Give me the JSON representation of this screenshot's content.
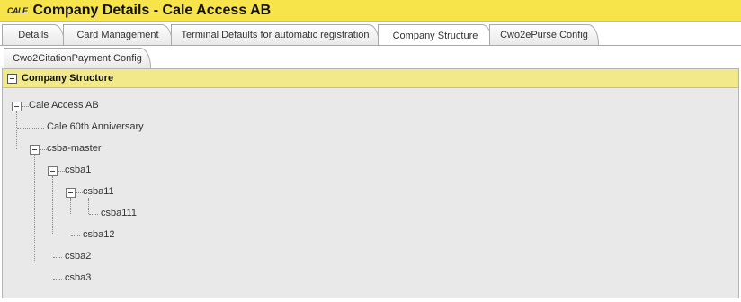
{
  "header": {
    "logo_text": "CALE",
    "title": "Company Details - Cale Access AB"
  },
  "tabs": [
    {
      "label": "Details"
    },
    {
      "label": "Card Management"
    },
    {
      "label": "Terminal Defaults for automatic registration"
    },
    {
      "label": "Company Structure",
      "active": true
    },
    {
      "label": "Cwo2ePurse Config"
    },
    {
      "label": "Cwo2CitationPayment Config"
    }
  ],
  "panel": {
    "title": "Company Structure"
  },
  "tree": {
    "nodes": [
      {
        "label": "Cale Access AB",
        "expandable": true
      },
      {
        "label": "Cale 60th Anniversary",
        "expandable": false
      },
      {
        "label": "csba-master",
        "expandable": true
      },
      {
        "label": "csba1",
        "expandable": true
      },
      {
        "label": "csba11",
        "expandable": true
      },
      {
        "label": "csba111",
        "expandable": false
      },
      {
        "label": "csba12",
        "expandable": false
      },
      {
        "label": "csba2",
        "expandable": false
      },
      {
        "label": "csba3",
        "expandable": false
      }
    ]
  },
  "colors": {
    "title_bar": "#f7e34a",
    "panel_header": "#f2ea8a",
    "panel_bg": "#e9e9e9"
  }
}
